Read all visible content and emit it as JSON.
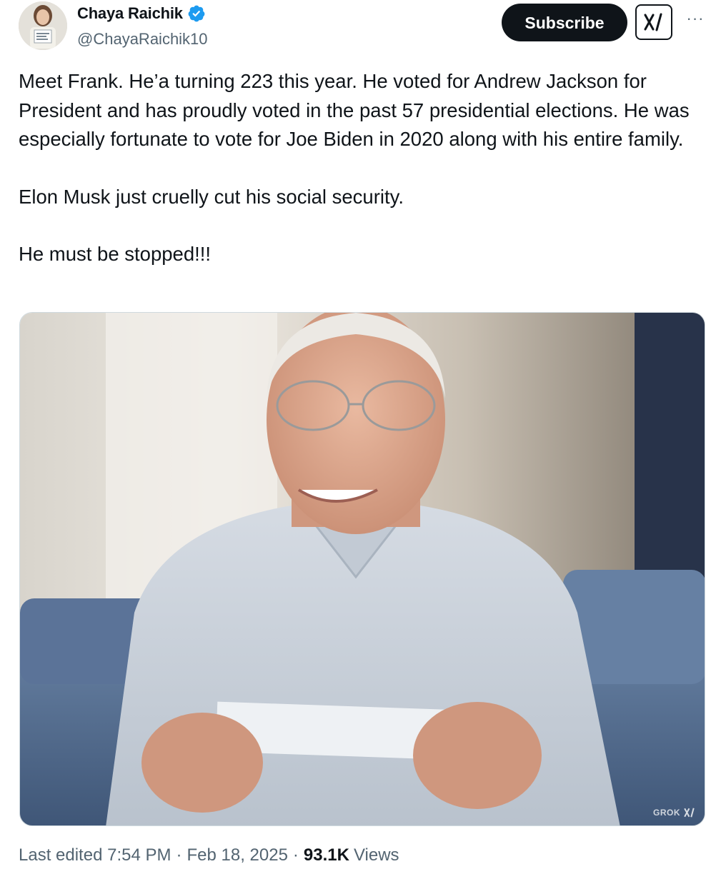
{
  "author": {
    "display_name": "Chaya Raichik",
    "handle": "@ChayaRaichik10",
    "verified_icon": "verified-badge-icon",
    "verified_color": "#1d9bf0"
  },
  "actions": {
    "subscribe_label": "Subscribe",
    "grok_icon": "grok-icon",
    "more_icon": "more-options-icon"
  },
  "tweet": {
    "paragraphs": [
      "Meet Frank. He’a turning 223 this year. He voted for Andrew Jackson for President and has proudly voted in the past 57 presidential elections. He was especially fortunate to vote for Joe Biden in 2020 along with his entire family.",
      "Elon Musk just cruelly cut his social security.",
      "He must be stopped!!!"
    ]
  },
  "media": {
    "watermark": "GROK"
  },
  "meta": {
    "edited_label": "Last edited 7:54 PM",
    "separator": "·",
    "date": "Feb 18, 2025",
    "views_count": "93.1K",
    "views_label": "Views"
  }
}
